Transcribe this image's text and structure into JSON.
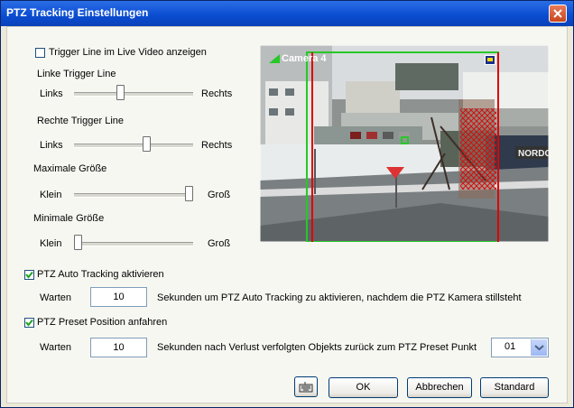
{
  "window": {
    "title": "PTZ Tracking Einstellungen"
  },
  "trigger_checkbox": {
    "label": "Trigger Line im Live Video anzeigen",
    "checked": false
  },
  "sliders": [
    {
      "title": "Linke Trigger Line",
      "left": "Links",
      "right": "Rechts",
      "value": 0.38
    },
    {
      "title": "Rechte Trigger Line",
      "left": "Links",
      "right": "Rechts",
      "value": 0.62
    },
    {
      "title": "Maximale Größe",
      "left": "Klein",
      "right": "Groß",
      "value": 1.0
    },
    {
      "title": "Minimale Größe",
      "left": "Klein",
      "right": "Groß",
      "value": 0.0
    }
  ],
  "video": {
    "camera_label": "Camera 4",
    "store_sign": "NORDC"
  },
  "auto_tracking": {
    "label": "PTZ Auto Tracking aktivieren",
    "checked": true,
    "wait_label": "Warten",
    "seconds": "10",
    "description": "Sekunden um PTZ Auto Tracking zu aktivieren, nachdem die PTZ Kamera stillsteht"
  },
  "preset": {
    "label": "PTZ Preset Position anfahren",
    "checked": true,
    "wait_label": "Warten",
    "seconds": "10",
    "description": "Sekunden nach Verlust verfolgten Objekts zurück zum PTZ Preset Punkt",
    "point": "01"
  },
  "buttons": {
    "ok": "OK",
    "cancel": "Abbrechen",
    "default": "Standard"
  },
  "colors": {
    "title_bar": "#0A4BD0",
    "trigger_left": "#FF0000",
    "trigger_right": "#00C000",
    "dialog": "#ECE9D8"
  }
}
